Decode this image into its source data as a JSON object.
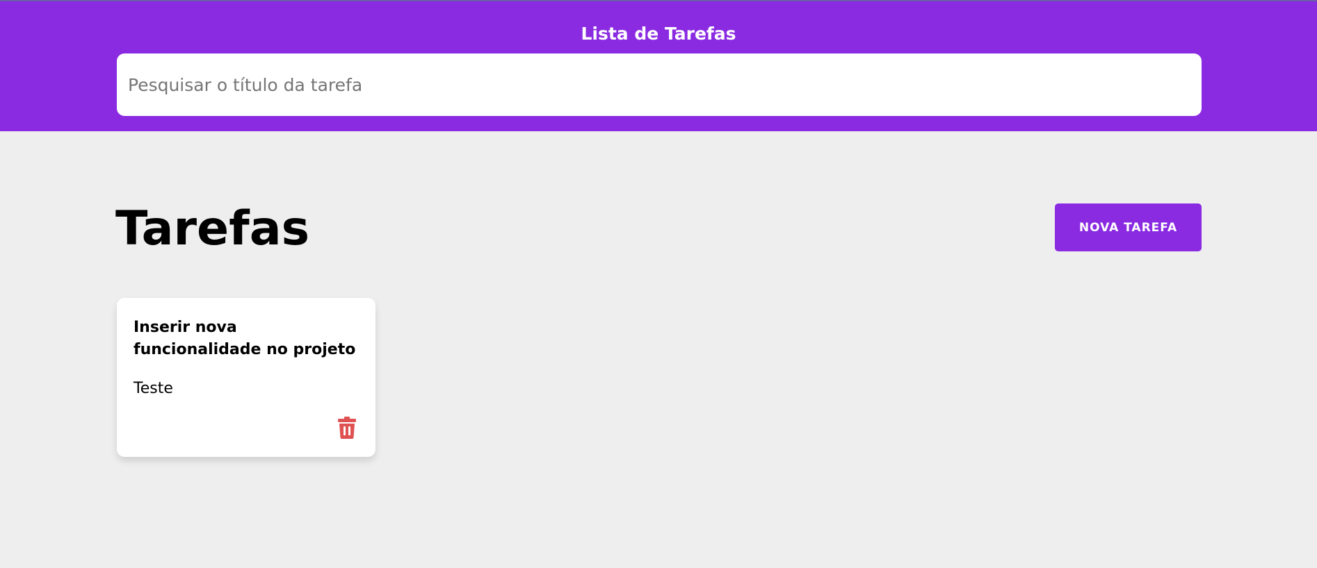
{
  "header": {
    "title": "Lista de Tarefas",
    "search_placeholder": "Pesquisar o título da tarefa",
    "search_value": ""
  },
  "main": {
    "title": "Tarefas",
    "new_task_label": "NOVA TAREFA",
    "tasks": [
      {
        "title": "Inserir nova funcionalidade no projeto",
        "description": "Teste",
        "delete_icon": "trash-icon"
      }
    ]
  },
  "colors": {
    "accent": "#8a2be2",
    "background": "#eeeeee",
    "danger": "#e05252"
  }
}
